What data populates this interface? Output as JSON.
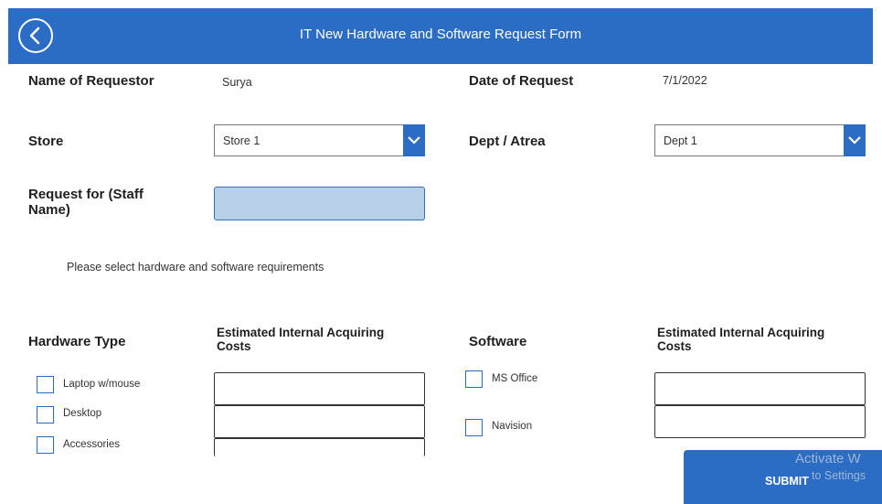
{
  "header": {
    "title": "IT New Hardware and Software Request Form"
  },
  "requestor": {
    "label": "Name of Requestor",
    "value": "Surya"
  },
  "date": {
    "label": "Date of Request",
    "value": "7/1/2022"
  },
  "store": {
    "label": "Store",
    "selected": "Store 1"
  },
  "dept": {
    "label": "Dept / Atrea",
    "selected": "Dept 1"
  },
  "staff": {
    "label": "Request for (Staff Name)",
    "value": ""
  },
  "instruction": "Please select hardware and software requirements",
  "hardware": {
    "heading": "Hardware Type",
    "cost_heading": "Estimated Internal Acquiring Costs",
    "items": [
      {
        "label": "Laptop w/mouse",
        "checked": false
      },
      {
        "label": "Desktop",
        "checked": false
      },
      {
        "label": "Accessories",
        "checked": false
      }
    ]
  },
  "software": {
    "heading": "Software",
    "cost_heading": "Estimated Internal Acquiring Costs",
    "items": [
      {
        "label": "MS Office",
        "checked": false
      },
      {
        "label": "Navision",
        "checked": false
      }
    ]
  },
  "submit": {
    "label": "SUBMIT"
  },
  "watermark": {
    "line1": "Activate W",
    "line2": "to Settings"
  },
  "colors": {
    "accent": "#2b6cc4",
    "input_fill": "#b8cfe8"
  },
  "icons": {
    "back": "chevron-left-circle-icon",
    "dropdown": "chevron-down-icon"
  }
}
